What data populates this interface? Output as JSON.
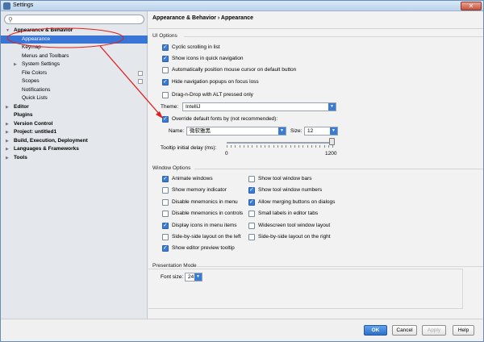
{
  "window": {
    "title": "Settings",
    "close_glyph": "✕"
  },
  "search": {
    "icon": "⚲",
    "value": ""
  },
  "tree": [
    {
      "label": "Appearance & Behavior",
      "bold": true,
      "expanded": true,
      "level": 0
    },
    {
      "label": "Appearance",
      "selected": true,
      "level": 1
    },
    {
      "label": "Keymap",
      "level": 1
    },
    {
      "label": "Menus and Toolbars",
      "level": 1
    },
    {
      "label": "System Settings",
      "collapsed": true,
      "level": 1
    },
    {
      "label": "File Colors",
      "level": 1,
      "side_icon": true
    },
    {
      "label": "Scopes",
      "level": 1,
      "side_icon": true
    },
    {
      "label": "Notifications",
      "level": 1
    },
    {
      "label": "Quick Lists",
      "level": 1
    },
    {
      "label": "Editor",
      "bold": true,
      "collapsed": true,
      "level": 0
    },
    {
      "label": "Plugins",
      "bold": true,
      "level": 0
    },
    {
      "label": "Version Control",
      "bold": true,
      "collapsed": true,
      "level": 0
    },
    {
      "label": "Project: untitled1",
      "bold": true,
      "collapsed": true,
      "level": 0
    },
    {
      "label": "Build, Execution, Deployment",
      "bold": true,
      "collapsed": true,
      "level": 0
    },
    {
      "label": "Languages & Frameworks",
      "bold": true,
      "collapsed": true,
      "level": 0
    },
    {
      "label": "Tools",
      "bold": true,
      "collapsed": true,
      "level": 0
    }
  ],
  "breadcrumb": "Appearance & Behavior › Appearance",
  "ui_options": {
    "label": "UI Options",
    "checkboxes": [
      {
        "label": "Cyclic scrolling in list",
        "checked": true
      },
      {
        "label": "Show icons in quick navigation",
        "checked": true
      },
      {
        "label": "Automatically position mouse cursor on default button",
        "checked": false
      },
      {
        "label": "Hide navigation popups on focus loss",
        "checked": true
      },
      {
        "label": "Drag-n-Drop with ALT pressed only",
        "checked": false
      }
    ],
    "theme_label": "Theme:",
    "theme_value": "IntelliJ",
    "override_fonts": {
      "label": "Override default fonts by (not recommended):",
      "checked": true
    },
    "name_label": "Name:",
    "name_value": "微软雅黑",
    "size_label": "Size:",
    "size_value": "12",
    "tooltip_label": "Tooltip initial delay (ms):",
    "slider_min": "0",
    "slider_max": "1200",
    "slider_value_fraction": 1.0
  },
  "window_options": {
    "label": "Window Options",
    "left": [
      {
        "label": "Animate windows",
        "checked": true
      },
      {
        "label": "Show memory indicator",
        "checked": false
      },
      {
        "label": "Disable mnemonics in menu",
        "checked": false
      },
      {
        "label": "Disable mnemonics in controls",
        "checked": false
      },
      {
        "label": "Display icons in menu items",
        "checked": true
      },
      {
        "label": "Side-by-side layout on the left",
        "checked": false
      },
      {
        "label": "Show editor preview tooltip",
        "checked": true
      }
    ],
    "right": [
      {
        "label": "Show tool window bars",
        "checked": false
      },
      {
        "label": "Show tool window numbers",
        "checked": true
      },
      {
        "label": "Allow merging buttons on dialogs",
        "checked": true
      },
      {
        "label": "Small labels in editor tabs",
        "checked": false
      },
      {
        "label": "Widescreen tool window layout",
        "checked": false
      },
      {
        "label": "Side-by-side layout on the right",
        "checked": false
      }
    ]
  },
  "presentation": {
    "label": "Presentation Mode",
    "font_size_label": "Font size:",
    "font_size_value": "24"
  },
  "footer": {
    "ok": "OK",
    "cancel": "Cancel",
    "apply": "Apply",
    "help": "Help"
  },
  "colors": {
    "selection": "#3875d7",
    "annotation": "#e0201c",
    "checkbox": "#3a7bd5"
  },
  "dropdown_glyph": "▼"
}
